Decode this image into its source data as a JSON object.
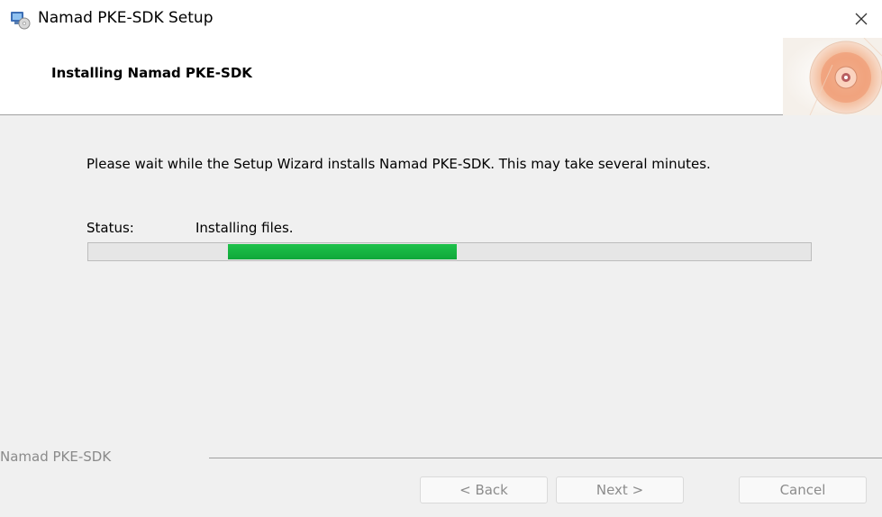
{
  "window": {
    "title": "Namad PKE-SDK Setup",
    "icon": "installer-icon",
    "close_icon": "close-icon"
  },
  "banner": {
    "title": "Installing Namad PKE-SDK",
    "graphic": "cd-disc-graphic"
  },
  "body": {
    "intro": "Please wait while the Setup Wizard installs Namad PKE-SDK.  This may take several minutes.",
    "status_label": "Status:",
    "status_value": "Installing files.",
    "progress_indeterminate": true,
    "progress_fill_color": "#1ec14b"
  },
  "footer": {
    "brand": "Namad PKE-SDK",
    "back_label": "< Back",
    "next_label": "Next >",
    "cancel_label": "Cancel"
  }
}
